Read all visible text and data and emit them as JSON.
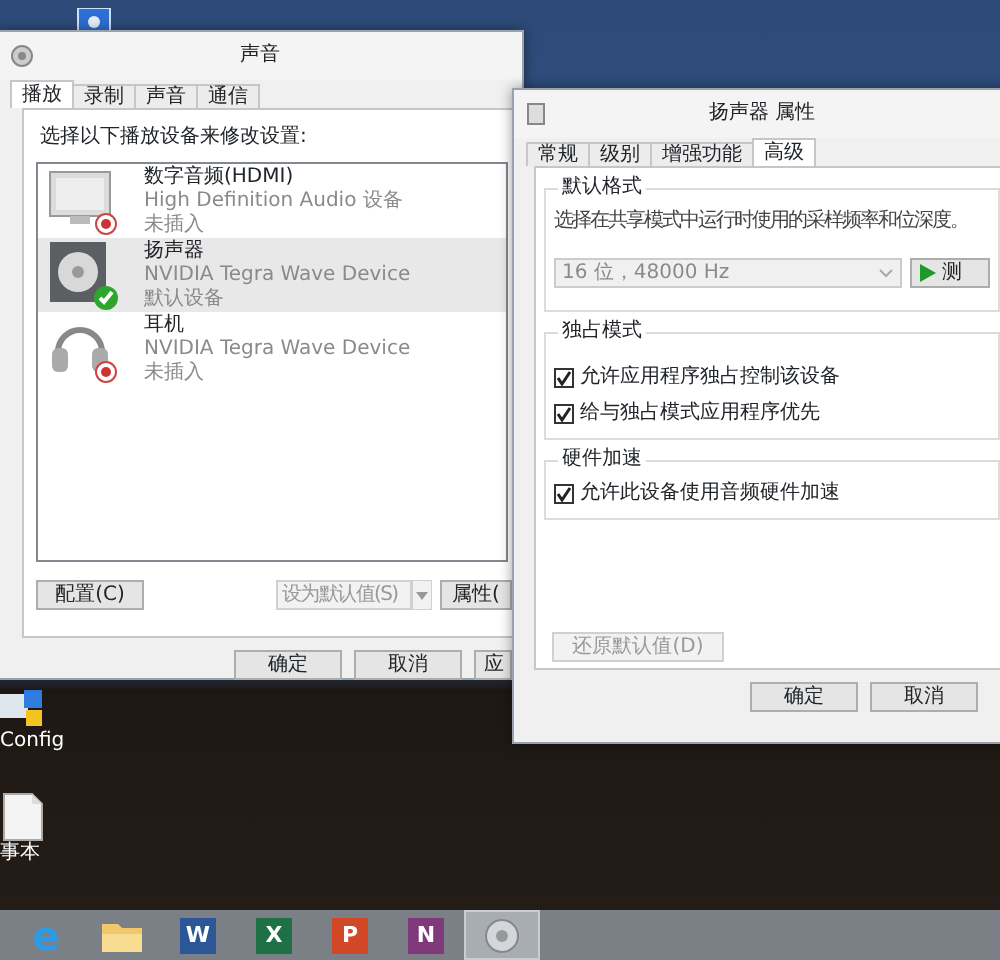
{
  "desktop_icons": [
    {
      "kind": "app"
    },
    {
      "kind": "config",
      "label": "Config"
    },
    {
      "kind": "notepad",
      "label": "事本"
    }
  ],
  "sound_window": {
    "title": "声音",
    "tabs": [
      {
        "label": "播放",
        "selected": true
      },
      {
        "label": "录制",
        "selected": false
      },
      {
        "label": "声音",
        "selected": false
      },
      {
        "label": "通信",
        "selected": false
      }
    ],
    "instruction": "选择以下播放设备来修改设置:",
    "devices": [
      {
        "kind": "monitor",
        "name": "数字音频(HDMI)",
        "driver": "High Definition Audio 设备",
        "status": "未插入",
        "default": false,
        "selected": false
      },
      {
        "kind": "speaker",
        "name": "扬声器",
        "driver": "NVIDIA Tegra Wave Device",
        "status": "默认设备",
        "default": true,
        "selected": true
      },
      {
        "kind": "headphones",
        "name": "耳机",
        "driver": "NVIDIA Tegra Wave Device",
        "status": "未插入",
        "default": false,
        "selected": false
      }
    ],
    "configure_button": {
      "label": "配置(C)",
      "disabled": false
    },
    "set_default_button": {
      "label": "设为默认值(S)",
      "disabled": true
    },
    "properties_button": {
      "label": "属性(",
      "disabled": false
    },
    "footer_buttons": [
      {
        "label": "确定",
        "disabled": false
      },
      {
        "label": "取消",
        "disabled": false
      },
      {
        "label": "应",
        "disabled": false
      }
    ]
  },
  "properties_window": {
    "title": "扬声器 属性",
    "tabs": [
      {
        "label": "常规",
        "selected": false
      },
      {
        "label": "级别",
        "selected": false
      },
      {
        "label": "增强功能",
        "selected": false
      },
      {
        "label": "高级",
        "selected": true
      }
    ],
    "default_format": {
      "heading": "默认格式",
      "description": "选择在共享模式中运行时使用的采样频率和位深度。",
      "format_value": "16 位，48000 Hz",
      "format_disabled": true,
      "test_button": "测"
    },
    "exclusive_mode": {
      "heading": "独占模式",
      "options": [
        {
          "label": "允许应用程序独占控制该设备",
          "checked": true
        },
        {
          "label": "给与独占模式应用程序优先",
          "checked": true
        }
      ]
    },
    "hardware_acceleration": {
      "heading": "硬件加速",
      "options": [
        {
          "label": "允许此设备使用音频硬件加速",
          "checked": true
        }
      ]
    },
    "restore_button": {
      "label": "还原默认值(D)",
      "disabled": true
    },
    "footer_buttons": [
      {
        "label": "确定",
        "disabled": false
      },
      {
        "label": "取消",
        "disabled": false
      }
    ]
  },
  "taskbar": {
    "apps": [
      {
        "kind": "ie",
        "glyph": "e",
        "selected": false
      },
      {
        "kind": "explorer",
        "selected": false
      },
      {
        "kind": "word",
        "glyph": "W",
        "selected": false
      },
      {
        "kind": "excel",
        "glyph": "X",
        "selected": false
      },
      {
        "kind": "powerpoint",
        "glyph": "P",
        "selected": false
      },
      {
        "kind": "onenote",
        "glyph": "N",
        "selected": false
      },
      {
        "kind": "sound",
        "selected": true
      }
    ]
  }
}
